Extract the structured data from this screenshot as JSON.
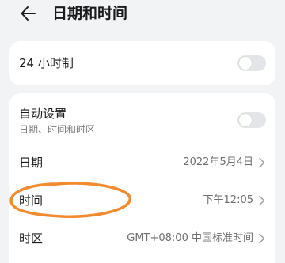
{
  "header": {
    "title": "日期和时间",
    "back_icon": "back-arrow-icon"
  },
  "format24": {
    "label": "24 小时制",
    "enabled": false
  },
  "auto": {
    "label": "自动设置",
    "sublabel": "日期、时间和时区",
    "enabled": false
  },
  "date": {
    "label": "日期",
    "value": "2022年5月4日"
  },
  "time": {
    "label": "时间",
    "value": "下午12:05"
  },
  "timezone": {
    "label": "时区",
    "value": "GMT+08:00 中国标准时间"
  },
  "colors": {
    "background": "#f1f3f5",
    "card": "#ffffff",
    "annotation": "#f28a2e",
    "toggle_off": "#e3e5e8"
  }
}
